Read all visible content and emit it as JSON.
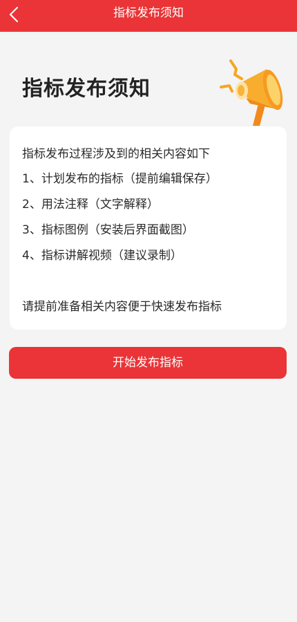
{
  "header": {
    "title": "指标发布须知"
  },
  "hero": {
    "title": "指标发布须知"
  },
  "card": {
    "intro": "指标发布过程涉及到的相关内容如下",
    "items": [
      "1、计划发布的指标（提前编辑保存）",
      "2、用法注释（文字解释）",
      "3、指标图例（安装后界面截图）",
      "4、指标讲解视频（建议录制）"
    ],
    "note": "请提前准备相关内容便于快速发布指标"
  },
  "actions": {
    "start_label": "开始发布指标"
  },
  "colors": {
    "accent": "#ea3437",
    "background": "#f4f4f4"
  },
  "icons": {
    "back": "chevron-left-icon",
    "hero": "megaphone-icon"
  }
}
